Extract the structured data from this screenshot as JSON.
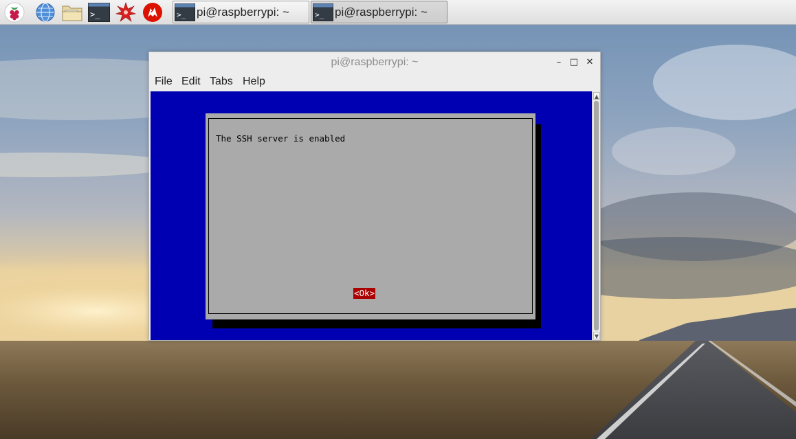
{
  "taskbar": {
    "launchers": [
      {
        "name": "raspberry-menu-icon"
      },
      {
        "name": "web-browser-icon"
      },
      {
        "name": "file-manager-icon"
      },
      {
        "name": "terminal-icon"
      },
      {
        "name": "mathematica-icon"
      },
      {
        "name": "wolfram-icon"
      }
    ],
    "tasks": [
      {
        "label": "pi@raspberrypi: ~",
        "active": false
      },
      {
        "label": "pi@raspberrypi: ~",
        "active": true
      }
    ]
  },
  "window": {
    "title": "pi@raspberrypi: ~",
    "controls": {
      "minimize": "–",
      "maximize": "□",
      "close": "✕"
    },
    "menu": [
      "File",
      "Edit",
      "Tabs",
      "Help"
    ]
  },
  "dialog": {
    "message": "The SSH server is enabled",
    "ok_label": "<Ok>"
  },
  "colors": {
    "terminal_bg": "#0000b2",
    "dialog_bg": "#aaaaaa",
    "ok_bg": "#aa0000"
  },
  "scrollbar": {
    "up": "▲",
    "down": "▼"
  }
}
